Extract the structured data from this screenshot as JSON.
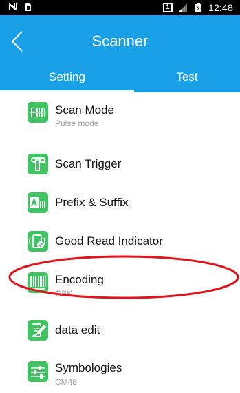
{
  "status_bar": {
    "time": "12:48",
    "sim_label": "1"
  },
  "app_bar": {
    "title": "Scanner",
    "back_icon": "chevron-left-icon",
    "tabs": [
      {
        "label": "Setting",
        "selected": true
      },
      {
        "label": "Test",
        "selected": false
      }
    ]
  },
  "settings": {
    "items": [
      {
        "label": "Scan Mode",
        "subtitle": "Pulse mode",
        "icon": "scan-mode-icon"
      },
      {
        "label": "Scan Trigger",
        "subtitle": "",
        "icon": "scan-trigger-icon"
      },
      {
        "label": "Prefix & Suffix",
        "subtitle": "",
        "icon": "prefix-suffix-icon"
      },
      {
        "label": "Good Read Indicator",
        "subtitle": "",
        "icon": "good-read-indicator-icon"
      },
      {
        "label": "Encoding",
        "subtitle": "GBK",
        "icon": "barcode-icon"
      },
      {
        "label": "data edit",
        "subtitle": "",
        "icon": "edit-icon"
      },
      {
        "label": "Symbologies",
        "subtitle": "CM48",
        "icon": "sliders-icon"
      }
    ]
  },
  "colors": {
    "accent": "#1aa0e6",
    "icon_green": "#41c363",
    "annotation_red": "#e0141c"
  }
}
